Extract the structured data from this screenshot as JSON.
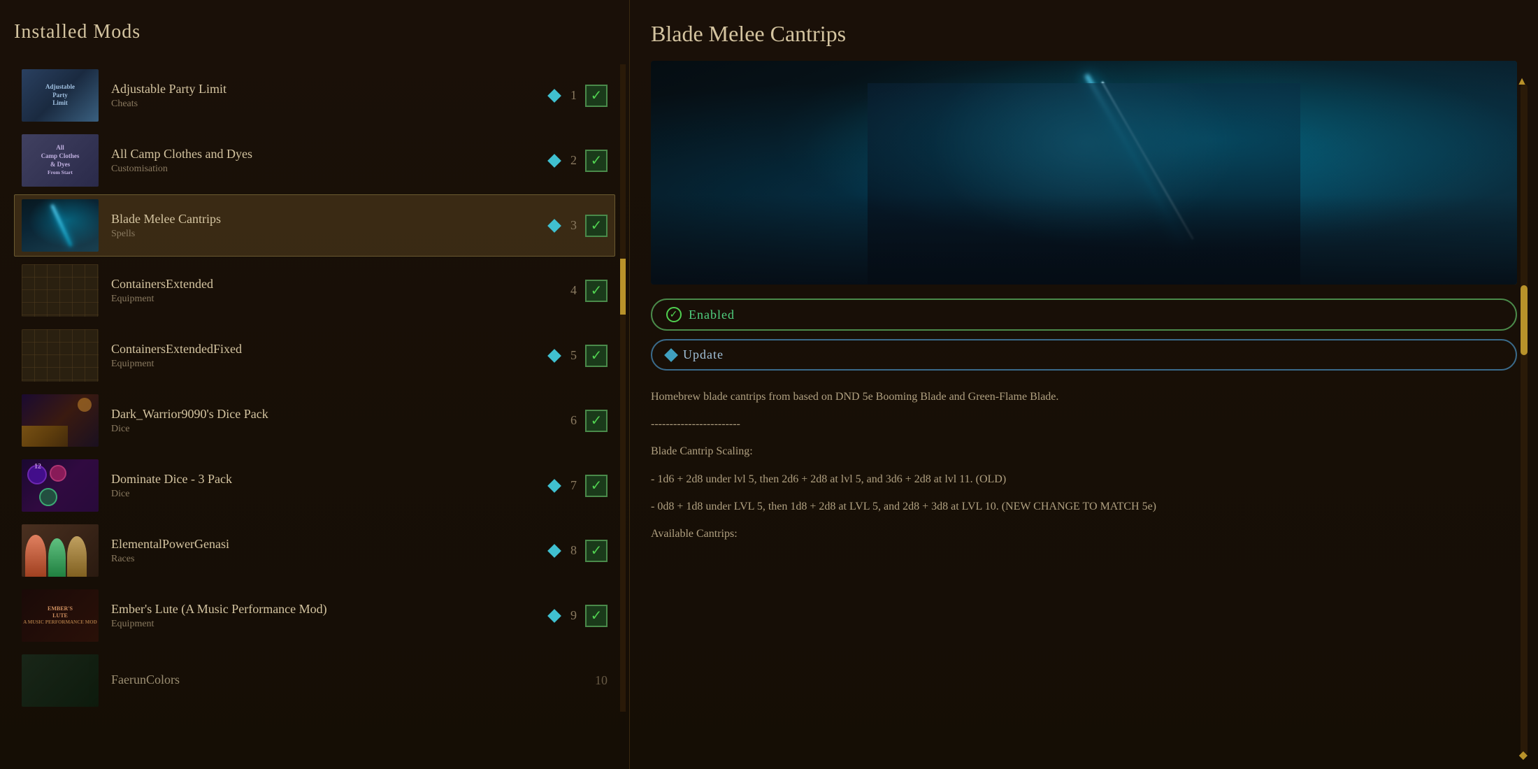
{
  "leftPanel": {
    "title": "Installed Mods",
    "mods": [
      {
        "id": 1,
        "name": "Adjustable Party Limit",
        "category": "Cheats",
        "number": "1",
        "hasDiamond": true,
        "enabled": true,
        "selected": false,
        "thumbClass": "thumb-1"
      },
      {
        "id": 2,
        "name": "All Camp Clothes and Dyes",
        "category": "Customisation",
        "number": "2",
        "hasDiamond": true,
        "enabled": true,
        "selected": false,
        "thumbClass": "thumb-2"
      },
      {
        "id": 3,
        "name": "Blade Melee Cantrips",
        "category": "Spells",
        "number": "3",
        "hasDiamond": true,
        "enabled": true,
        "selected": true,
        "thumbClass": "thumb-3"
      },
      {
        "id": 4,
        "name": "ContainersExtended",
        "category": "Equipment",
        "number": "4",
        "hasDiamond": false,
        "enabled": true,
        "selected": false,
        "thumbClass": "thumb-4"
      },
      {
        "id": 5,
        "name": "ContainersExtendedFixed",
        "category": "Equipment",
        "number": "5",
        "hasDiamond": true,
        "enabled": true,
        "selected": false,
        "thumbClass": "thumb-5"
      },
      {
        "id": 6,
        "name": "Dark_Warrior9090's Dice Pack",
        "category": "Dice",
        "number": "6",
        "hasDiamond": false,
        "enabled": true,
        "selected": false,
        "thumbClass": "thumb-6"
      },
      {
        "id": 7,
        "name": "Dominate Dice - 3 Pack",
        "category": "Dice",
        "number": "7",
        "hasDiamond": true,
        "enabled": true,
        "selected": false,
        "thumbClass": "thumb-7"
      },
      {
        "id": 8,
        "name": "ElementalPowerGenasi",
        "category": "Races",
        "number": "8",
        "hasDiamond": true,
        "enabled": true,
        "selected": false,
        "thumbClass": "thumb-8"
      },
      {
        "id": 9,
        "name": "Ember's Lute (A Music Performance Mod)",
        "category": "Equipment",
        "number": "9",
        "hasDiamond": true,
        "enabled": true,
        "selected": false,
        "thumbClass": "thumb-9"
      },
      {
        "id": 10,
        "name": "FaerunColors",
        "category": "",
        "number": "10",
        "hasDiamond": false,
        "enabled": true,
        "selected": false,
        "thumbClass": "thumb-10"
      }
    ]
  },
  "rightPanel": {
    "title": "Blade Melee Cantrips",
    "enabledLabel": "Enabled",
    "updateLabel": "Update",
    "divider": "------------------------",
    "description": [
      "Homebrew blade cantrips from based on DND 5e Booming Blade and Green-Flame Blade.",
      "------------------------",
      "Blade Cantrip Scaling:",
      "- 1d6 + 2d8 under lvl 5, then 2d6 + 2d8 at lvl 5, and 3d6 + 2d8 at lvl 11. (OLD)",
      "- 0d8 + 1d8 under LVL 5, then 1d8 + 2d8 at LVL 5, and 2d8 + 3d8 at LVL 10. (NEW CHANGE TO MATCH 5e)",
      "Available Cantrips:"
    ]
  }
}
